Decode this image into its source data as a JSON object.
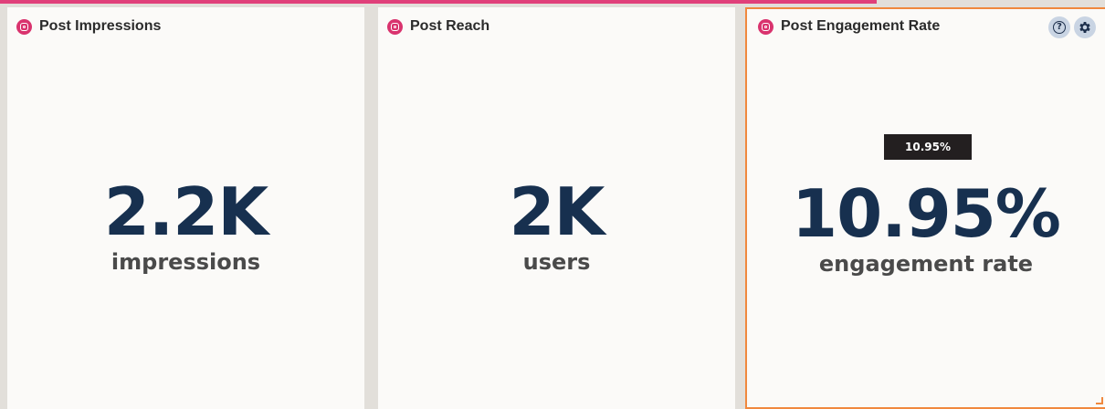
{
  "widgets": [
    {
      "title": "Post Impressions",
      "value": "2.2K",
      "label": "impressions",
      "icon": "instagram-icon"
    },
    {
      "title": "Post Reach",
      "value": "2K",
      "label": "users",
      "icon": "instagram-icon"
    },
    {
      "title": "Post Engagement Rate",
      "value": "10.95%",
      "label": "engagement rate",
      "icon": "instagram-icon",
      "tooltip": "10.95%",
      "actions": [
        "help-icon",
        "gear-icon"
      ]
    }
  ],
  "colors": {
    "accent_bar": "#e0407a",
    "instagram": "#d9336e",
    "value_text": "#17304f",
    "selected_border": "#f0883e"
  }
}
